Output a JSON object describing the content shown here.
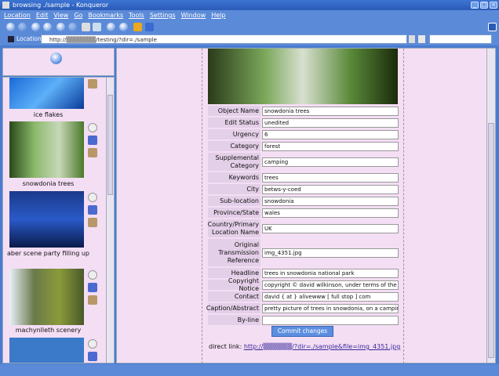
{
  "window": {
    "title": "browsing ./sample - Konqueror"
  },
  "menu": [
    "Location",
    "Edit",
    "View",
    "Go",
    "Bookmarks",
    "Tools",
    "Settings",
    "Window",
    "Help"
  ],
  "location": {
    "label": "Location:",
    "url": "http://▒▒▒▒▒▒▒/testing/?dir=./sample"
  },
  "sidebar": {
    "items": [
      {
        "caption": "ice flakes"
      },
      {
        "caption": "snowdonia trees"
      },
      {
        "caption": "aber scene party filling up"
      },
      {
        "caption": "machynlleth scenery"
      }
    ]
  },
  "form": {
    "fields": [
      {
        "label": "Object Name",
        "value": "snowdonia trees"
      },
      {
        "label": "Edit Status",
        "value": "unedited"
      },
      {
        "label": "Urgency",
        "value": "6"
      },
      {
        "label": "Category",
        "value": "forest"
      },
      {
        "label": "Supplemental Category",
        "value": "camping"
      },
      {
        "label": "Keywords",
        "value": "trees"
      },
      {
        "label": "City",
        "value": "betws-y-coed"
      },
      {
        "label": "Sub-location",
        "value": "snowdonia"
      },
      {
        "label": "Province/State",
        "value": "wales"
      },
      {
        "label": "Country/Primary Location Name",
        "value": "UK"
      },
      {
        "label": "Original Transmission Reference",
        "value": "img_4351.jpg"
      },
      {
        "label": "Headline",
        "value": "trees in snowdonia national park"
      },
      {
        "label": "Copyright Notice",
        "value": "copyright © david wilkinson, under terms of the c"
      },
      {
        "label": "Contact",
        "value": "david { at } alivewww [ full stop ] com"
      },
      {
        "label": "Caption/Abstract",
        "value": "pretty picture of trees in snowdonia, on a campin"
      },
      {
        "label": "By-line",
        "value": ""
      }
    ],
    "commit_label": "Commit changes",
    "direct_link_label": "direct link:",
    "direct_link": "http://▒▒▒▒▒▒/?dir=./sample&file=img_4351.jpg"
  }
}
